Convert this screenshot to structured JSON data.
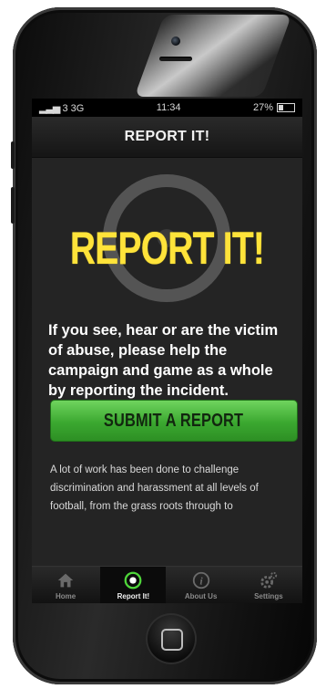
{
  "status": {
    "carrier": "3 3G",
    "time": "11:34",
    "battery": "27%"
  },
  "navbar": {
    "title": "REPORT IT!"
  },
  "hero": {
    "title": "REPORT IT!"
  },
  "intro": {
    "text": "If you see, hear or are the victim of abuse, please help the campaign and game as a whole by reporting the incident."
  },
  "submit": {
    "label": "SUBMIT A REPORT"
  },
  "body": {
    "text": "A lot of work has been done to challenge discrimination and harassment at all levels of football, from the grass roots through to"
  },
  "tabs": [
    {
      "label": "Home",
      "icon": "home-icon",
      "active": false
    },
    {
      "label": "Report It!",
      "icon": "target-icon",
      "active": true
    },
    {
      "label": "About Us",
      "icon": "info-icon",
      "active": false
    },
    {
      "label": "Settings",
      "icon": "gear-icon",
      "active": false
    }
  ],
  "colors": {
    "accent_yellow": "#ffe33a",
    "button_green": "#3ba830"
  }
}
